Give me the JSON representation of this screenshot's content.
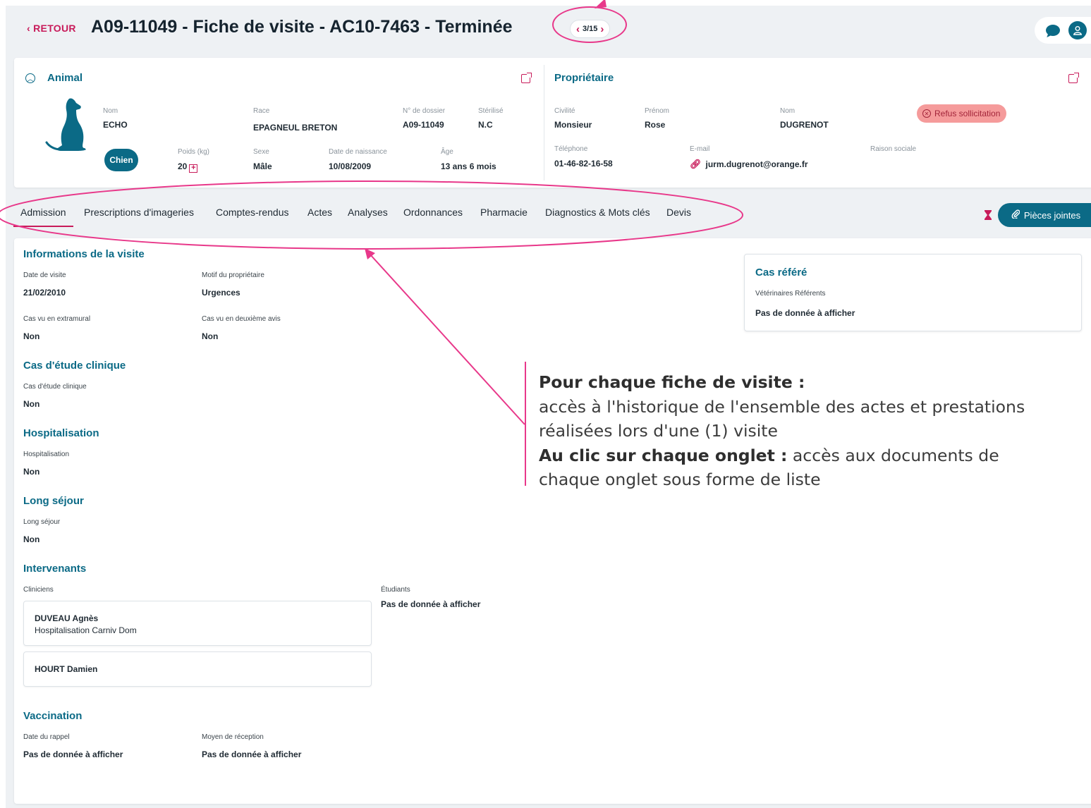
{
  "header": {
    "back_label": "‹ RETOUR",
    "title": "A09-11049 - Fiche de visite - AC10-7463 - Terminée",
    "pager_text": "3/15"
  },
  "animal": {
    "section_title": "Animal",
    "species": "Chien",
    "fields": {
      "nom_label": "Nom",
      "nom": "ECHO",
      "race_label": "Race",
      "race": "EPAGNEUL BRETON",
      "dossier_label": "N° de dossier",
      "dossier": "A09-11049",
      "sterilise_label": "Stérilisé",
      "sterilise": "N.C",
      "poids_label": "Poids (kg)",
      "poids": "20",
      "sexe_label": "Sexe",
      "sexe": "Mâle",
      "naissance_label": "Date de naissance",
      "naissance": "10/08/2009",
      "age_label": "Âge",
      "age": "13 ans 6 mois"
    }
  },
  "owner": {
    "section_title": "Propriétaire",
    "refus_badge": "Refus sollicitation",
    "fields": {
      "civilite_label": "Civilité",
      "civilite": "Monsieur",
      "prenom_label": "Prénom",
      "prenom": "Rose",
      "nom_label": "Nom",
      "nom": "DUGRENOT",
      "tel_label": "Téléphone",
      "tel": "01-46-82-16-58",
      "email_label": "E-mail",
      "email": "jurm.dugrenot@orange.fr",
      "raison_label": "Raison sociale"
    }
  },
  "tabs": [
    "Admission",
    "Prescriptions d'imageries",
    "Comptes-rendus",
    "Actes",
    "Analyses",
    "Ordonnances",
    "Pharmacie",
    "Diagnostics & Mots clés",
    "Devis"
  ],
  "attachments_label": "Pièces jointes",
  "visit": {
    "title": "Informations de la visite",
    "date_label": "Date de visite",
    "date": "21/02/2010",
    "motif_label": "Motif du propriétaire",
    "motif": "Urgences",
    "extramural_label": "Cas vu en extramural",
    "extramural": "Non",
    "deuxieme_label": "Cas vu en deuxième avis",
    "deuxieme": "Non"
  },
  "etude": {
    "title": "Cas d'étude clinique",
    "label": "Cas d'étude clinique",
    "value": "Non"
  },
  "hospitalisation": {
    "title": "Hospitalisation",
    "label": "Hospitalisation",
    "value": "Non"
  },
  "long_sejour": {
    "title": "Long séjour",
    "label": "Long séjour",
    "value": "Non"
  },
  "intervenants": {
    "title": "Intervenants",
    "cliniciens_label": "Cliniciens",
    "cliniciens": [
      {
        "name": "DUVEAU Agnès",
        "service": "Hospitalisation Carniv Dom"
      },
      {
        "name": "HOURT Damien",
        "service": ""
      }
    ],
    "etudiants_label": "Étudiants",
    "etudiants_value": "Pas de donnée à afficher"
  },
  "vaccination": {
    "title": "Vaccination",
    "rappel_label": "Date du rappel",
    "rappel": "Pas de donnée à afficher",
    "reception_label": "Moyen de réception",
    "reception": "Pas de donnée à afficher"
  },
  "cas_refere": {
    "title": "Cas référé",
    "label": "Vétérinaires Référents",
    "value": "Pas de donnée à afficher"
  },
  "annotation": {
    "heading1": "Pour chaque fiche de visite :",
    "text1": "accès à l'historique de l'ensemble des actes et prestations réalisées lors d'une (1) visite",
    "heading2": "Au clic sur chaque onglet :",
    "text2": " accès aux documents de chaque onglet sous forme de liste"
  },
  "colors": {
    "accent": "#0b6a86",
    "brand": "#c81b5a",
    "annotation": "#e8388a",
    "badge": "#f59b9b"
  }
}
